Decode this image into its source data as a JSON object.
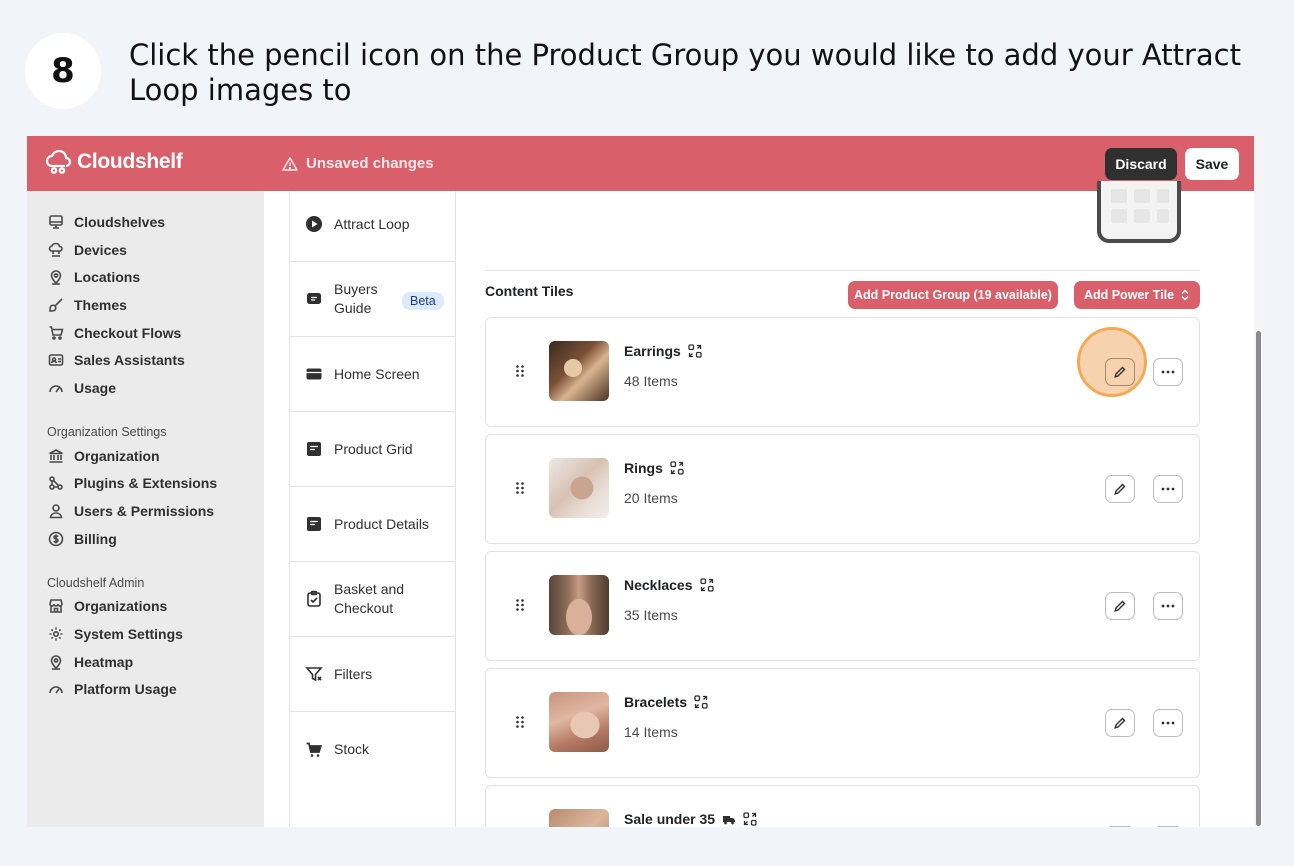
{
  "step": {
    "number": "8",
    "instruction": "Click the pencil icon on the Product Group you would like to add your Attract Loop images to"
  },
  "topbar": {
    "brand": "Cloudshelf",
    "status": "Unsaved changes",
    "discard_label": "Discard",
    "save_label": "Save",
    "color": "#d9606b"
  },
  "sidebar": {
    "main_items": [
      {
        "label": "Cloudshelves",
        "icon": "cloudshelves-icon"
      },
      {
        "label": "Devices",
        "icon": "devices-icon"
      },
      {
        "label": "Locations",
        "icon": "location-pin-icon"
      },
      {
        "label": "Themes",
        "icon": "brush-icon"
      },
      {
        "label": "Checkout Flows",
        "icon": "cart-icon"
      },
      {
        "label": "Sales Assistants",
        "icon": "id-card-icon"
      },
      {
        "label": "Usage",
        "icon": "gauge-icon"
      }
    ],
    "org_section": "Organization Settings",
    "org_items": [
      {
        "label": "Organization",
        "icon": "bank-icon"
      },
      {
        "label": "Plugins & Extensions",
        "icon": "plugins-icon"
      },
      {
        "label": "Users & Permissions",
        "icon": "user-icon"
      },
      {
        "label": "Billing",
        "icon": "dollar-icon"
      }
    ],
    "admin_section": "Cloudshelf Admin",
    "admin_items": [
      {
        "label": "Organizations",
        "icon": "store-icon"
      },
      {
        "label": "System Settings",
        "icon": "gear-icon"
      },
      {
        "label": "Heatmap",
        "icon": "location-pin-icon"
      },
      {
        "label": "Platform Usage",
        "icon": "gauge-icon"
      }
    ]
  },
  "settings_nav": [
    {
      "label": "Attract Loop",
      "icon": "play-circle-icon"
    },
    {
      "label": "Buyers Guide",
      "icon": "chat-icon",
      "badge": "Beta"
    },
    {
      "label": "Home Screen",
      "icon": "card-icon"
    },
    {
      "label": "Product Grid",
      "icon": "document-icon"
    },
    {
      "label": "Product Details",
      "icon": "document-icon"
    },
    {
      "label": "Basket and Checkout",
      "icon": "clipboard-check-icon"
    },
    {
      "label": "Filters",
      "icon": "filter-icon"
    },
    {
      "label": "Stock",
      "icon": "cart-icon"
    }
  ],
  "content": {
    "section_title": "Content Tiles",
    "add_group_label": "Add Product Group (19 available)",
    "add_power_label": "Add Power Tile",
    "tiles": [
      {
        "name": "Earrings",
        "count": "48 Items",
        "highlighted": true
      },
      {
        "name": "Rings",
        "count": "20 Items",
        "highlighted": false
      },
      {
        "name": "Necklaces",
        "count": "35 Items",
        "highlighted": false
      },
      {
        "name": "Bracelets",
        "count": "14 Items",
        "highlighted": false
      },
      {
        "name": "Sale under 35",
        "count": "",
        "highlighted": false
      }
    ]
  }
}
